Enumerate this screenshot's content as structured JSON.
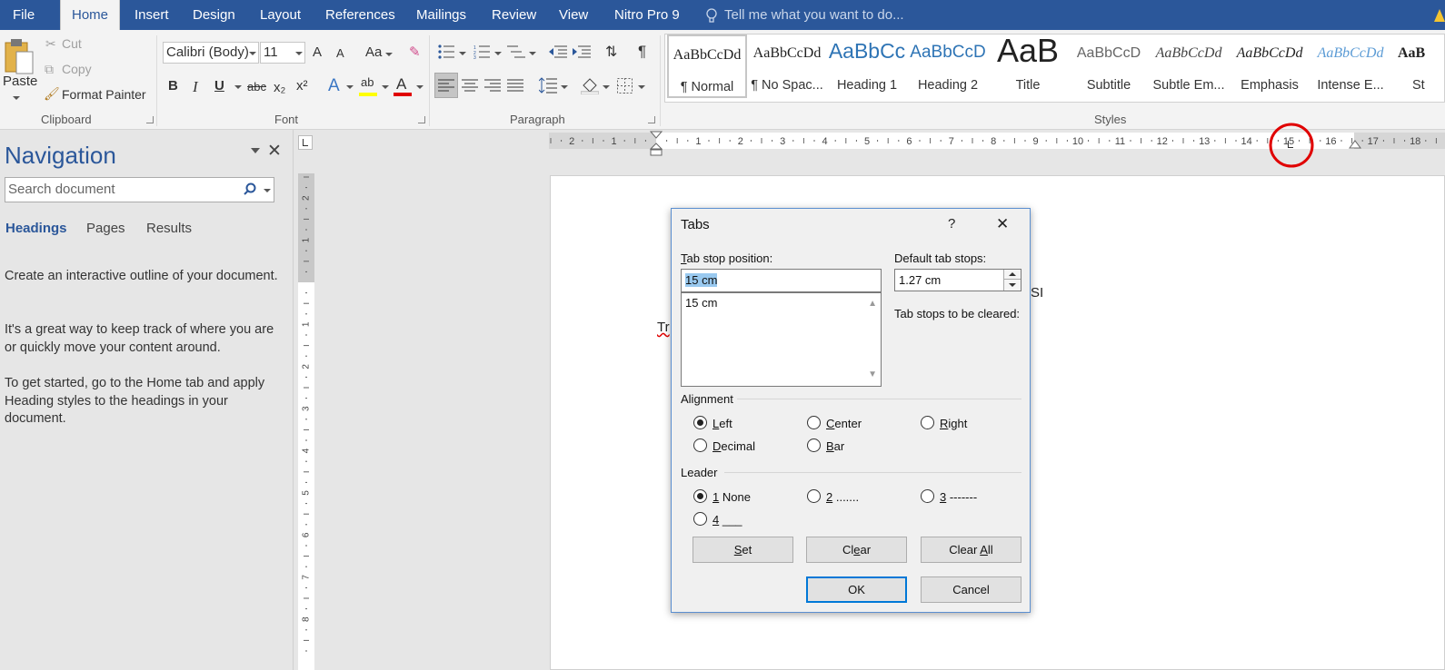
{
  "tabs": [
    "File",
    "Home",
    "Insert",
    "Design",
    "Layout",
    "References",
    "Mailings",
    "Review",
    "View",
    "Nitro Pro 9"
  ],
  "tell_me": "Tell me what you want to do...",
  "clipboard": {
    "paste": "Paste",
    "cut": "Cut",
    "copy": "Copy",
    "format_painter": "Format Painter",
    "group": "Clipboard"
  },
  "font": {
    "name": "Calibri (Body)",
    "size": "11",
    "group": "Font",
    "grow": "A",
    "shrink": "A",
    "case": "Aa",
    "bold": "B",
    "italic": "I",
    "underline": "U",
    "strike": "abc",
    "sub": "x₂",
    "sup": "x²",
    "effects": "A",
    "highlight": "ab",
    "color": "A"
  },
  "paragraph": {
    "group": "Paragraph"
  },
  "styles": {
    "group": "Styles",
    "items": [
      {
        "preview": "AaBbCcDd",
        "name": "¶ Normal"
      },
      {
        "preview": "AaBbCcDd",
        "name": "¶ No Spac..."
      },
      {
        "preview": "AaBbCc",
        "name": "Heading 1"
      },
      {
        "preview": "AaBbCcD",
        "name": "Heading 2"
      },
      {
        "preview": "AaB",
        "name": "Title"
      },
      {
        "preview": "AaBbCcD",
        "name": "Subtitle"
      },
      {
        "preview": "AaBbCcDd",
        "name": "Subtle Em..."
      },
      {
        "preview": "AaBbCcDd",
        "name": "Emphasis"
      },
      {
        "preview": "AaBbCcDd",
        "name": "Intense E..."
      },
      {
        "preview": "AaB",
        "name": "St"
      }
    ]
  },
  "nav": {
    "title": "Navigation",
    "search_placeholder": "Search document",
    "tabs": [
      "Headings",
      "Pages",
      "Results"
    ],
    "p1": "Create an interactive outline of your document.",
    "p2": "It's a great way to keep track of where you are or quickly move your content around.",
    "p3": "To get started, go to the Home tab and apply Heading styles to the headings in your document."
  },
  "ruler_labels": [
    "2",
    "1",
    "1",
    "2",
    "3",
    "4",
    "5",
    "6",
    "7",
    "8",
    "9",
    "10",
    "11",
    "12",
    "13",
    "14",
    "15",
    "16",
    "17",
    "18"
  ],
  "vruler_labels": [
    "2",
    "1",
    "1",
    "2",
    "3",
    "4",
    "5",
    "6",
    "7",
    "8"
  ],
  "doc": {
    "text_left": "Tr",
    "text_right": "SI"
  },
  "dialog": {
    "title": "Tabs",
    "help": "?",
    "close": "✕",
    "tab_stop_label_u": "T",
    "tab_stop_label": "ab stop position:",
    "tab_stop_value": "15 cm",
    "list_items": [
      "15 cm"
    ],
    "default_label": "Default tab stops:",
    "default_value": "1.27 cm",
    "cleared_label": "Tab stops to be cleared:",
    "alignment_label": "Alignment",
    "align_options": [
      {
        "u": "L",
        "rest": "eft",
        "selected": true
      },
      {
        "u": "C",
        "rest": "enter",
        "selected": false
      },
      {
        "u": "R",
        "rest": "ight",
        "selected": false
      },
      {
        "u": "D",
        "rest": "ecimal",
        "selected": false
      },
      {
        "u": "B",
        "rest": "ar",
        "selected": false
      }
    ],
    "leader_label": "Leader",
    "leader_options": [
      {
        "u": "1",
        "rest": " None",
        "selected": true
      },
      {
        "u": "2",
        "rest": " .......",
        "selected": false
      },
      {
        "u": "3",
        "rest": " -------",
        "selected": false
      },
      {
        "u": "4",
        "rest": " ___",
        "selected": false
      }
    ],
    "set": {
      "u": "S",
      "rest": "et"
    },
    "clear": {
      "pre": "Cl",
      "u": "e",
      "rest": "ar"
    },
    "clear_all": {
      "pre": "Clear ",
      "u": "A",
      "rest": "ll"
    },
    "ok": "OK",
    "cancel": "Cancel"
  },
  "colors": {
    "brand": "#2b579a",
    "font_color_bar": "#e00000",
    "highlight_bar": "#ffff00",
    "annotation": "#e00000"
  }
}
